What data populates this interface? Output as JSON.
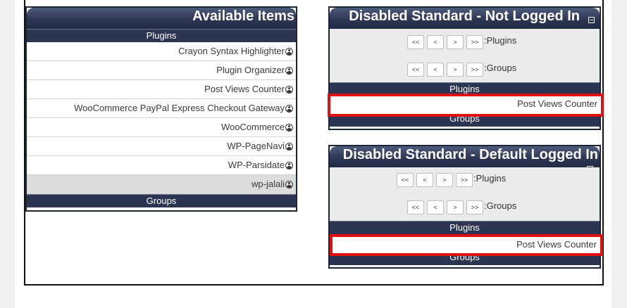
{
  "available": {
    "title": "Available Items",
    "plugins_bar": "Plugins",
    "groups_bar": "Groups",
    "items": [
      {
        "label": "Crayon Syntax Highlighter"
      },
      {
        "label": "Plugin Organizer"
      },
      {
        "label": "Post Views Counter"
      },
      {
        "label": "WooCommerce PayPal Express Checkout Gateway"
      },
      {
        "label": "WooCommerce"
      },
      {
        "label": "WP-PageNavi"
      },
      {
        "label": "WP-Parsidate"
      },
      {
        "label": "wp-jalali"
      }
    ]
  },
  "not_logged_in": {
    "title": "Disabled Standard - Not Logged In",
    "nav_buttons": [
      "<<",
      "<",
      ">",
      ">>"
    ],
    "plugins_nav_label": ":Plugins",
    "groups_nav_label": ":Groups",
    "plugins_bar": "Plugins",
    "groups_bar": "Groups",
    "item": "Post Views Counter"
  },
  "default_logged_in": {
    "title": "Disabled Standard - Default Logged In",
    "nav_buttons": [
      "<<",
      "<",
      ">",
      ">>"
    ],
    "plugins_nav_label": ":Plugins",
    "groups_nav_label": ":Groups",
    "plugins_bar": "Plugins",
    "groups_bar": "Groups",
    "item": "Post Views Counter"
  },
  "icons": {
    "item": "user-icon",
    "collapse": "collapse-icon"
  },
  "colors": {
    "header": "#2b3552",
    "highlight": "#e01010"
  }
}
